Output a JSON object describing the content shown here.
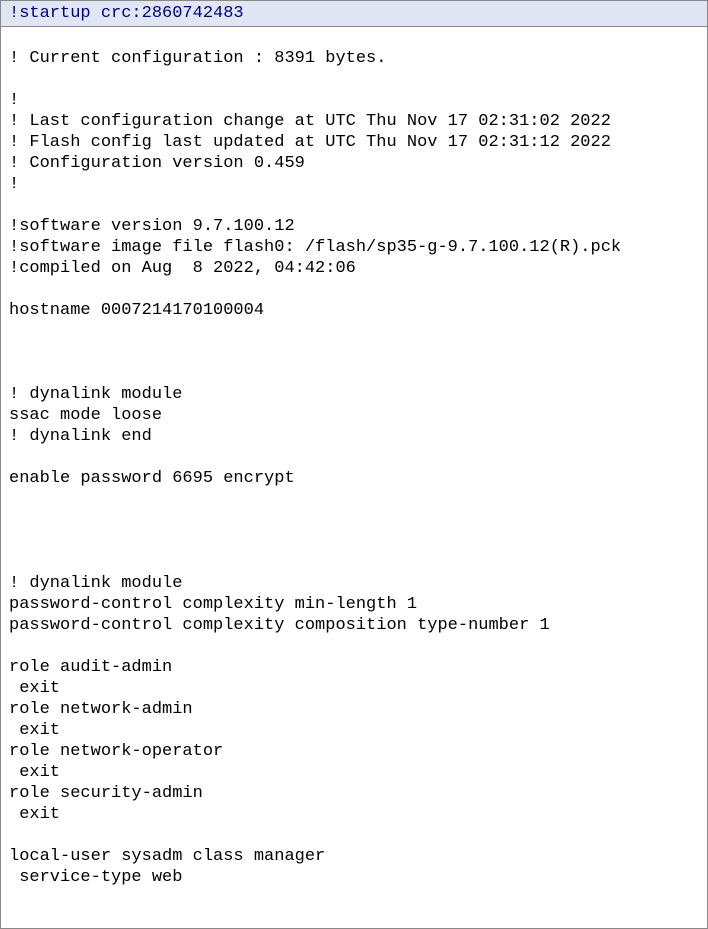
{
  "header": "!startup crc:2860742483",
  "config_lines": [
    "",
    "! Current configuration : 8391 bytes.",
    "",
    "!",
    "! Last configuration change at UTC Thu Nov 17 02:31:02 2022",
    "! Flash config last updated at UTC Thu Nov 17 02:31:12 2022",
    "! Configuration version 0.459",
    "!",
    "",
    "!software version 9.7.100.12",
    "!software image file flash0: /flash/sp35-g-9.7.100.12(R).pck",
    "!compiled on Aug  8 2022, 04:42:06",
    "",
    "hostname 0007214170100004",
    "",
    "",
    "",
    "! dynalink module",
    "ssac mode loose",
    "! dynalink end",
    "",
    "enable password 6695 encrypt",
    "",
    "",
    "",
    "",
    "! dynalink module",
    "password-control complexity min-length 1",
    "password-control complexity composition type-number 1",
    "",
    "role audit-admin",
    " exit",
    "role network-admin",
    " exit",
    "role network-operator",
    " exit",
    "role security-admin",
    " exit",
    "",
    "local-user sysadm class manager",
    " service-type web"
  ]
}
